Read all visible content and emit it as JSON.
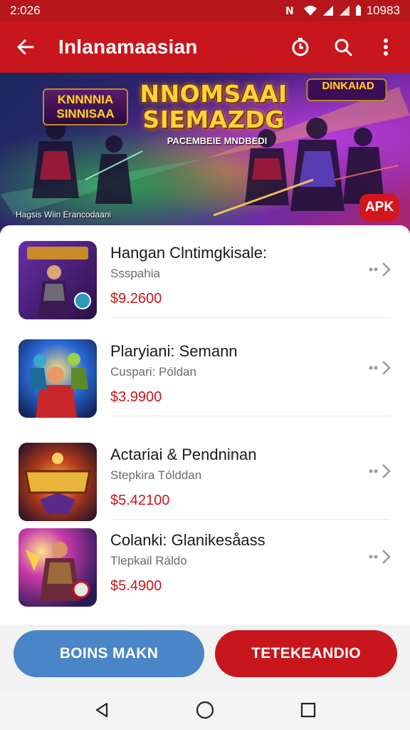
{
  "status_bar": {
    "time": "2:026",
    "battery_text": "10983",
    "icons": [
      "nfc-icon",
      "wifi-icon",
      "signal-icon",
      "signal-icon",
      "battery-icon"
    ]
  },
  "app_bar": {
    "title": "Inlanamaasian",
    "back_icon": "arrow-left-icon",
    "actions": [
      "timer-icon",
      "search-icon",
      "more-vert-icon"
    ]
  },
  "banner": {
    "title_line1": "NNOMSAAI",
    "title_line2": "SIEMAZDG",
    "subtitle": "PACEMBEIE MNDBEDI",
    "logo_left": "KNNNNIA SINNISAA",
    "logo_right": "DINKAIAD",
    "caption": "Hagsis Wiin Erancodaani",
    "badge": "APK"
  },
  "products": [
    {
      "name": "Hangan Clntimgkisale:",
      "developer": "Ssspahia",
      "price": "$9.2600"
    },
    {
      "name": "Plaryiani: Semann",
      "developer": "Cuspari: Póldan",
      "price": "$3.9900"
    },
    {
      "name": "Actariai & Pendninan",
      "developer": "Stepkira Tólddan",
      "price": "$5.42100"
    },
    {
      "name": "Colanki: Glanikesåass",
      "developer": "Tlepkail Ráldo",
      "price": "$5.4900"
    }
  ],
  "buttons": {
    "primary_label": "BOINS MAKN",
    "secondary_label": "TETEKEANDIO"
  },
  "colors": {
    "accent": "#c8161d",
    "status_bar": "#b5161b",
    "primary_button": "#4a86c7",
    "price": "#c8161d"
  },
  "nav": [
    "back-triangle-icon",
    "home-circle-icon",
    "recents-square-icon"
  ]
}
